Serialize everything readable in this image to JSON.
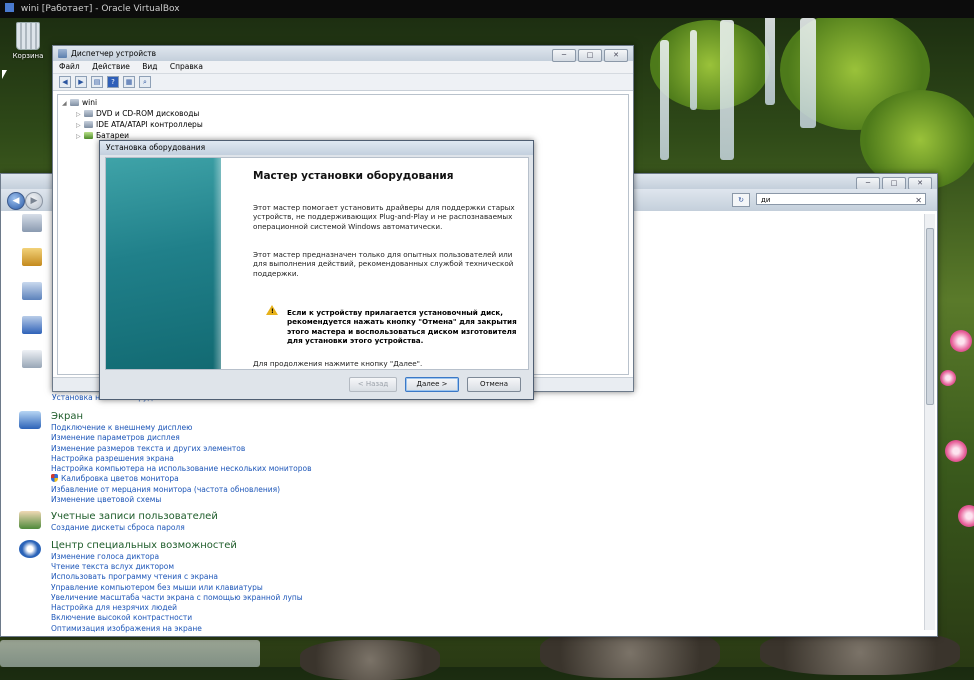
{
  "host": {
    "title": "wini [Работает] - Oracle VirtualBox"
  },
  "desktop": {
    "recycle_bin": "Корзина"
  },
  "device_manager": {
    "title": "Диспетчер устройств",
    "menu": [
      "Файл",
      "Действие",
      "Вид",
      "Справка"
    ],
    "root": "wini",
    "nodes": [
      "DVD и CD-ROM дисководы",
      "IDE ATA/ATAPI контроллеры",
      "Батареи"
    ]
  },
  "wizard": {
    "window_title": "Установка оборудования",
    "heading": "Мастер установки оборудования",
    "para1": "Этот мастер помогает установить драйверы для поддержки старых устройств, не поддерживающих Plug-and-Play и не распознаваемых операционной системой Windows автоматически.",
    "para2": "Этот мастер предназначен только для опытных пользователей или для выполнения действий, рекомендованных службой технической поддержки.",
    "warning": "Если к устройству прилагается установочный диск, рекомендуется нажать кнопку \"Отмена\" для закрытия этого мастера и воспользоваться диском изготовителя для установки этого устройства.",
    "continue_text": "Для продолжения нажмите кнопку \"Далее\".",
    "back": "< Назад",
    "next": "Далее >",
    "cancel": "Отмена"
  },
  "control_panel": {
    "search_value": "ди",
    "partial_link": "Установка нового оборудования",
    "screen": {
      "title": "Экран",
      "links": [
        "Подключение к внешнему дисплею",
        "Изменение параметров дисплея",
        "Изменение размеров текста и других элементов",
        "Настройка разрешения экрана",
        "Настройка компьютера на использование нескольких мониторов",
        "Калибровка цветов монитора",
        "Избавление от мерцания монитора (частота обновления)",
        "Изменение цветовой схемы"
      ]
    },
    "accounts": {
      "title": "Учетные записи пользователей",
      "links": [
        "Создание дискеты сброса пароля"
      ]
    },
    "access": {
      "title": "Центр специальных возможностей",
      "links": [
        "Изменение голоса диктора",
        "Чтение текста вслух диктором",
        "Использовать программу чтения с экрана",
        "Управление компьютером без мыши или клавиатуры",
        "Увеличение масштаба части экрана с помощью экранной лупы",
        "Настройка для незрячих людей",
        "Включение высокой контрастности",
        "Оптимизация изображения на экране"
      ]
    }
  }
}
